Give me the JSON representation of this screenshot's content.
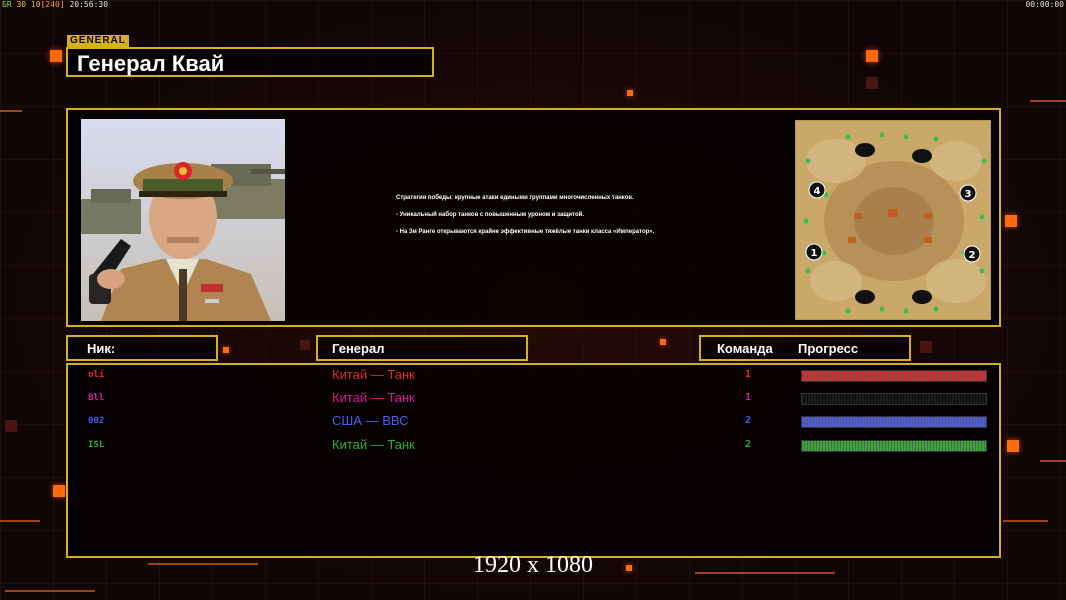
{
  "hud": {
    "tl_a": "БR",
    "tl_b": "30 10",
    "tl_c": "[240]",
    "tl_time": "20:56:30",
    "tr_time": "00:00:00"
  },
  "general": {
    "tag": "GENERAL",
    "name": "Генерал Квай",
    "strategy": [
      "Стратегия победы: крупные атаки едиными группами многочисленных танков.",
      "- Уникальный набор танков с повышенным уроном и защитой.",
      "- На 3м Ранге открываются крайне эффективные тяжёлые танки класса «Император»."
    ]
  },
  "minimap": {
    "start_labels": [
      "4",
      "3",
      "1",
      "2"
    ]
  },
  "headers": {
    "nick": "Ник:",
    "general": "Генерал",
    "team": "Команда",
    "progress": "Прогресс"
  },
  "players": [
    {
      "nick": "oli",
      "general": "Китай — Танк",
      "team": "1",
      "color": "#e02a2a",
      "progress": 1.0
    },
    {
      "nick": "Bll",
      "general": "Китай — Танк",
      "team": "1",
      "color": "#d21aa0",
      "progress": 0.0
    },
    {
      "nick": "002",
      "general": "США — ВВС",
      "team": "2",
      "color": "#4a5cf0",
      "progress": 1.0
    },
    {
      "nick": "ISL",
      "general": "Китай — Танк",
      "team": "2",
      "color": "#2fae2f",
      "progress": 1.0
    }
  ],
  "colors": {
    "accent": "#d6b21a",
    "deco": "#ff6a10",
    "background": "#110606"
  },
  "resolution_label": "1920 x 1080"
}
